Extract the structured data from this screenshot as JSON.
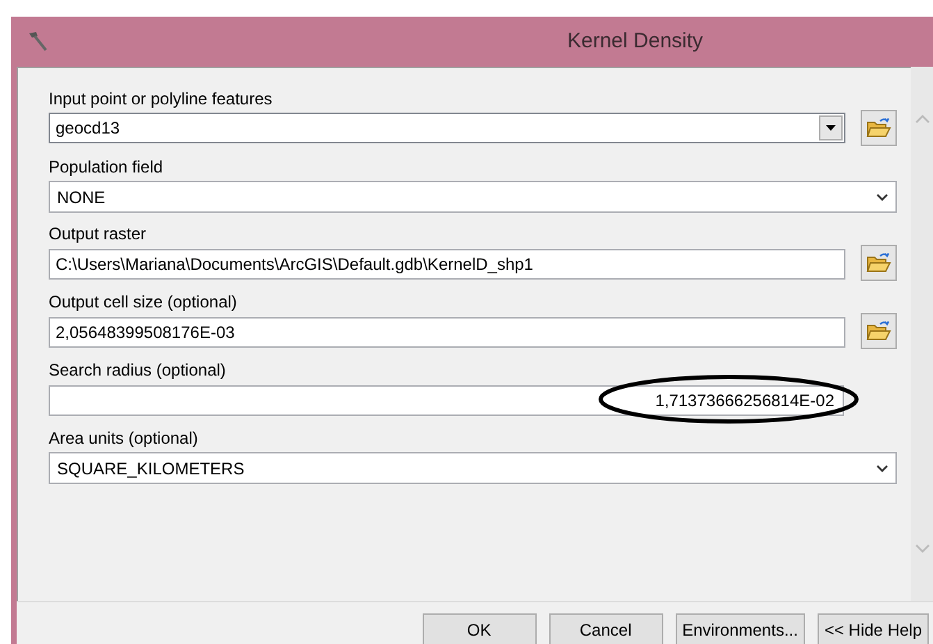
{
  "window": {
    "title": "Kernel Density"
  },
  "fields": [
    {
      "kind": "combo-browse",
      "label": "Input point or polyline features",
      "value": "geocd13"
    },
    {
      "kind": "dropdown",
      "label": "Population field",
      "value": "NONE"
    },
    {
      "kind": "text-browse",
      "label": "Output raster",
      "value": "C:\\Users\\Mariana\\Documents\\ArcGIS\\Default.gdb\\KernelD_shp1"
    },
    {
      "kind": "text-browse",
      "label": "Output cell size (optional)",
      "value": "2,05648399508176E-03"
    },
    {
      "kind": "text",
      "label": "Search radius (optional)",
      "value": "1,71373666256814E-02",
      "right_aligned": true,
      "circled": true
    },
    {
      "kind": "dropdown",
      "label": "Area units (optional)",
      "value": "SQUARE_KILOMETERS"
    }
  ],
  "buttons": [
    "OK",
    "Cancel",
    "Environments...",
    "<< Hide Help"
  ]
}
